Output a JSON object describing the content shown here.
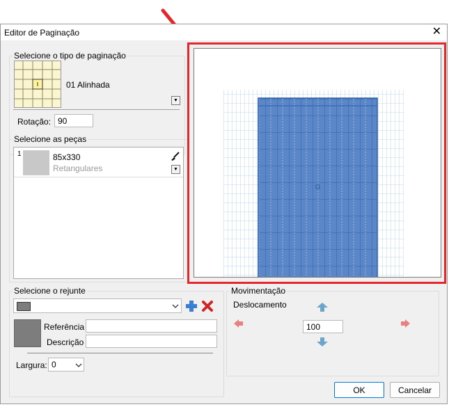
{
  "window": {
    "title": "Editor de Paginação",
    "close_glyph": "✕"
  },
  "paging_type": {
    "legend": "Selecione o tipo de paginação",
    "selected_name": "01 Alinhada",
    "rotation_label": "Rotação:",
    "rotation_value": "90"
  },
  "pieces": {
    "legend": "Selecione as peças",
    "items": [
      {
        "index": "1",
        "size": "85x330",
        "category": "Retangulares"
      }
    ]
  },
  "grout": {
    "legend": "Selecione o rejunte",
    "reference_label": "Referência",
    "description_label": "Descrição",
    "reference_value": "",
    "description_value": "",
    "width_label": "Largura:",
    "width_value": "0",
    "swatch_color": "#7d7d7d"
  },
  "movement": {
    "legend": "Movimentação",
    "displacement_label": "Deslocamento",
    "displacement_value": "100"
  },
  "buttons": {
    "ok": "OK",
    "cancel": "Cancelar"
  },
  "colors": {
    "annotation_red": "#e5262a",
    "tile_blue": "#5b87c9",
    "grid_light": "#a9cdea",
    "arrow_blue": "#4f86c6",
    "arrow_red": "#e56a6a"
  }
}
